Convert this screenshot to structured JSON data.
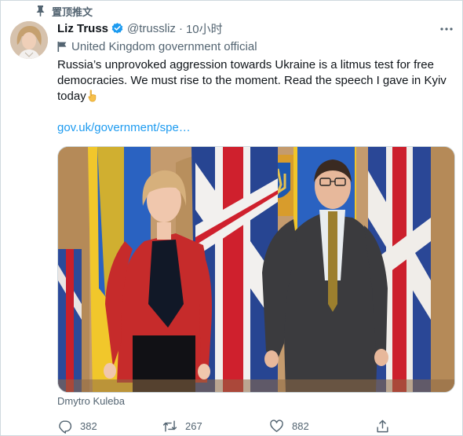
{
  "pinned": {
    "label": "置顶推文",
    "icon": "pin-icon"
  },
  "author": {
    "display_name": "Liz Truss",
    "verified": true,
    "handle": "@trussliz",
    "separator": "·",
    "time": "10小时",
    "label_icon": "flag-icon",
    "label": "United Kingdom government official"
  },
  "tweet": {
    "text": "Russia’s unprovoked aggression towards Ukraine is a litmus test for free democracies. We must rise to the moment. Read the speech I gave in Kyiv today",
    "emoji": "point-down-emoji",
    "link": "gov.uk/government/spe…"
  },
  "media": {
    "credit": "Dmytro Kuleba"
  },
  "actions": {
    "reply_count": "382",
    "retweet_count": "267",
    "like_count": "882"
  },
  "colors": {
    "accent": "#1d9bf0",
    "secondary_text": "#536471",
    "primary_text": "#0f1419",
    "border": "#cfd9de"
  }
}
